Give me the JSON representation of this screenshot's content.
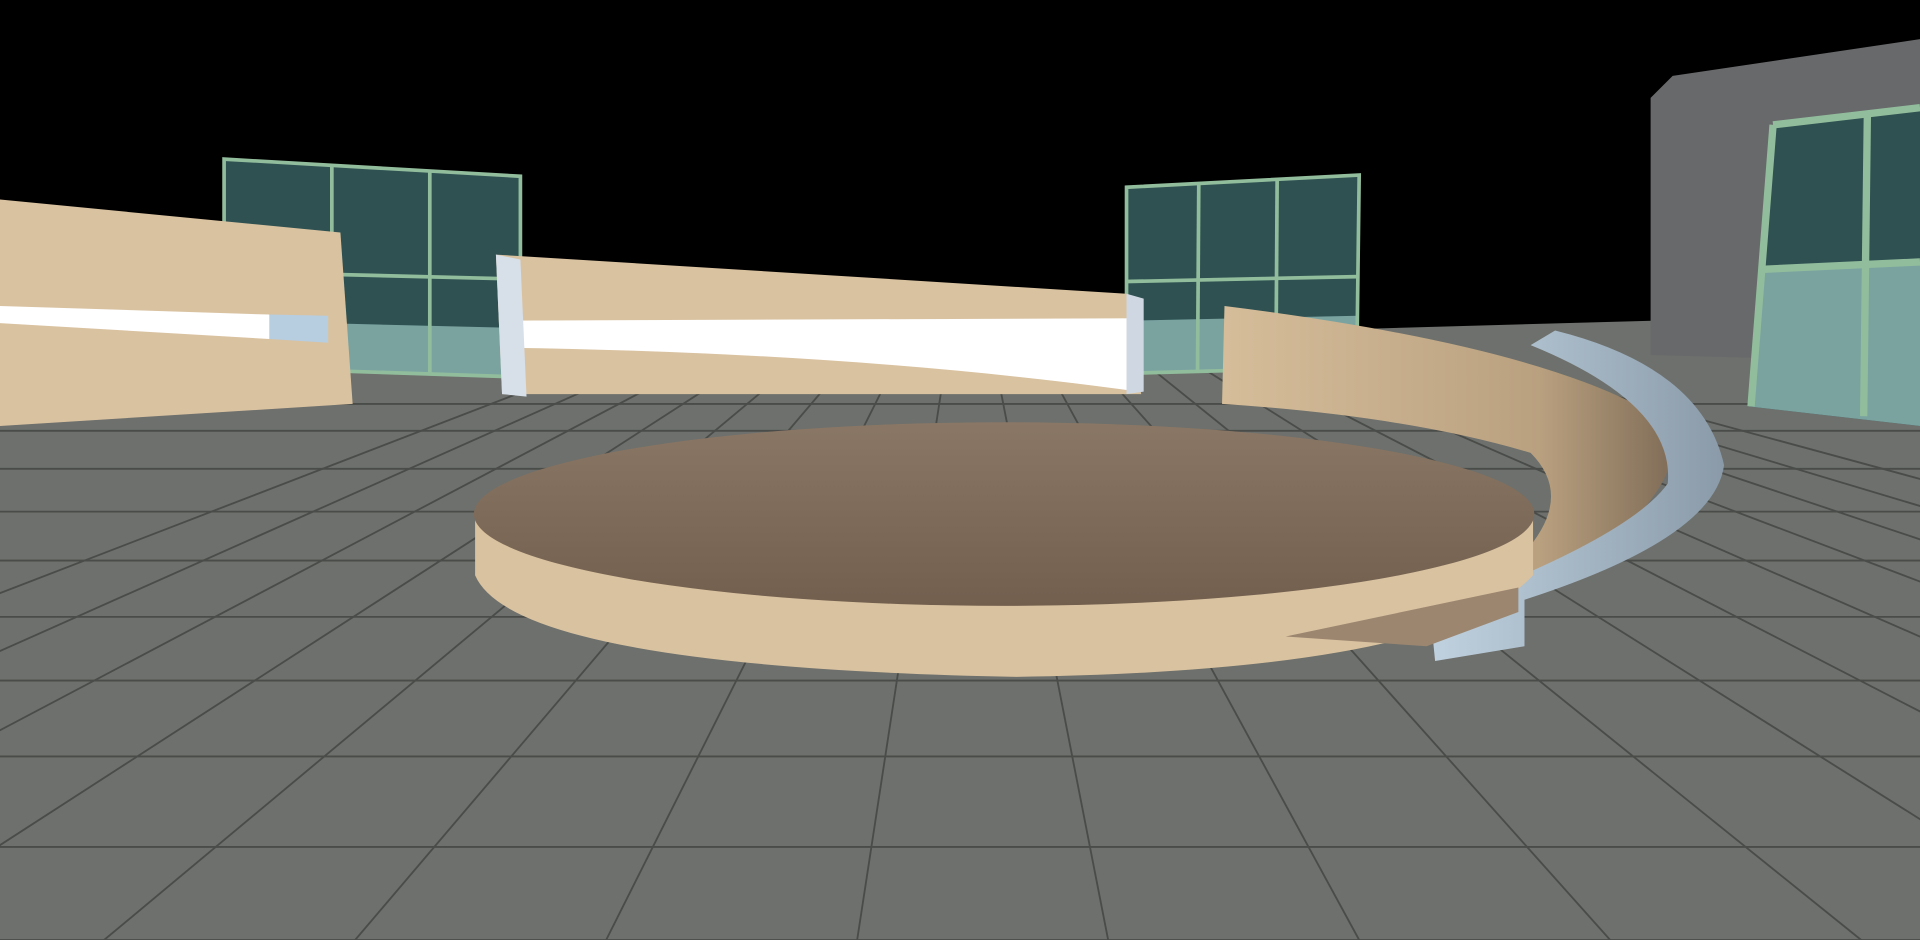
{
  "scene": {
    "colors": {
      "sky": "#000000",
      "ground": "#6d706c",
      "tile_line": "#4a4c49",
      "wood_light": "#d9c2a0",
      "wood_dark": "#7b6856",
      "glass_dark": "#2f5152",
      "glass_light": "#7aa3a0",
      "frame": "#92bd9c",
      "stripe": "#ffffff",
      "band": "#b3c6d6",
      "building": "#68696b"
    }
  }
}
